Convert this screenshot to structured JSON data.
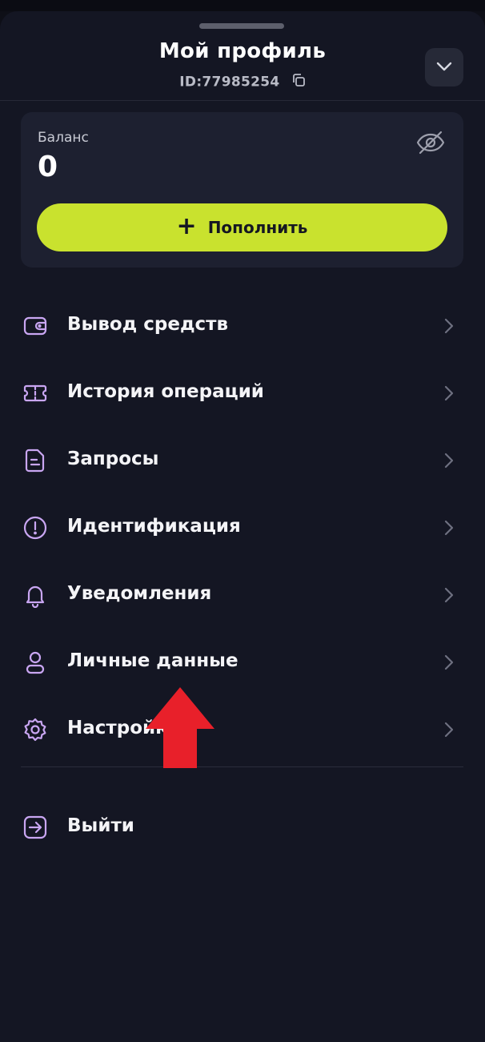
{
  "header": {
    "title": "Мой профиль",
    "id_text": "ID:77985254",
    "collapse_icon": "chevron-down-icon",
    "copy_icon": "copy-icon"
  },
  "balance": {
    "label": "Баланс",
    "value": "0",
    "visibility_icon": "eye-off-icon",
    "topup_label": "Пополнить",
    "topup_color": "#c9e22e"
  },
  "menu": [
    {
      "label": "Вывод средств",
      "icon": "wallet-icon"
    },
    {
      "label": "История операций",
      "icon": "ticket-icon"
    },
    {
      "label": "Запросы",
      "icon": "document-icon"
    },
    {
      "label": "Идентификация",
      "icon": "alert-circle-icon"
    },
    {
      "label": "Уведомления",
      "icon": "bell-icon"
    },
    {
      "label": "Личные данные",
      "icon": "user-icon"
    },
    {
      "label": "Настройки",
      "icon": "gear-icon"
    }
  ],
  "logout": {
    "label": "Выйти",
    "icon": "logout-icon"
  },
  "colors": {
    "icon_accent": "#c9a6f2",
    "background": "#141623",
    "annotation_arrow": "#e8202a"
  }
}
